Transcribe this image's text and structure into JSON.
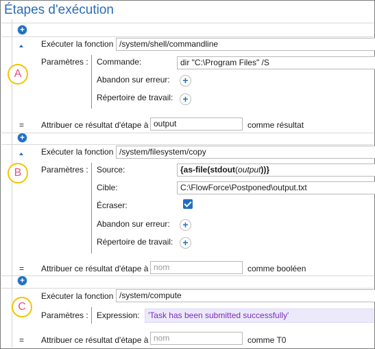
{
  "page": {
    "title": "Étapes d'exécution"
  },
  "step1": {
    "badge": "A",
    "execute_label": "Exécuter la fonction",
    "function_path": "/system/shell/commandline",
    "params_label": "Paramètres :",
    "params": [
      {
        "label": "Commande:",
        "value": "dir \"C:\\Program Files\" /S"
      },
      {
        "label": "Abandon sur erreur:"
      },
      {
        "label": "Répertoire de travail:"
      }
    ],
    "assign_eq": "=",
    "assign_label": "Attribuer ce résultat d'étape à",
    "assign_value": "output",
    "assign_suffix": "comme résultat"
  },
  "step2": {
    "badge": "B",
    "execute_label": "Exécuter la fonction",
    "function_path": "/system/filesystem/copy",
    "params_label": "Paramètres :",
    "source_label": "Source:",
    "source_expr": {
      "open": "{as-file(",
      "fn": "stdout",
      "paren_open": "(",
      "arg": "output",
      "close": "))}"
    },
    "target_label": "Cible:",
    "target_value": "C:\\FlowForce\\Postponed\\output.txt",
    "overwrite_label": "Écraser:",
    "overwrite_checked": true,
    "abort_label": "Abandon sur erreur:",
    "workdir_label": "Répertoire de travail:",
    "assign_eq": "=",
    "assign_label": "Attribuer ce résultat d'étape à",
    "assign_placeholder": "nom",
    "assign_suffix": "comme booléen"
  },
  "step3": {
    "badge": "C",
    "execute_label": "Exécuter la fonction",
    "function_path": "/system/compute",
    "params_label": "Paramètres :",
    "expression_label": "Expression:",
    "expression_value": "'Task has been submitted successfully'",
    "assign_eq": "=",
    "assign_label": "Attribuer ce résultat d'étape à",
    "assign_placeholder": "nom",
    "assign_suffix": "comme T0"
  },
  "icons": {
    "add_step": "plus-icon",
    "collapse": "triangle-up-icon",
    "add_param": "plus-circle-icon",
    "checkbox": "checkmark-icon"
  },
  "colors": {
    "accent": "#1f6fc5",
    "title": "#2a6cb5",
    "badge_ring": "#f2c500",
    "badge_text": "#e6507f",
    "expression_bg": "#ece9fb",
    "expression_text": "#7b2db8"
  }
}
